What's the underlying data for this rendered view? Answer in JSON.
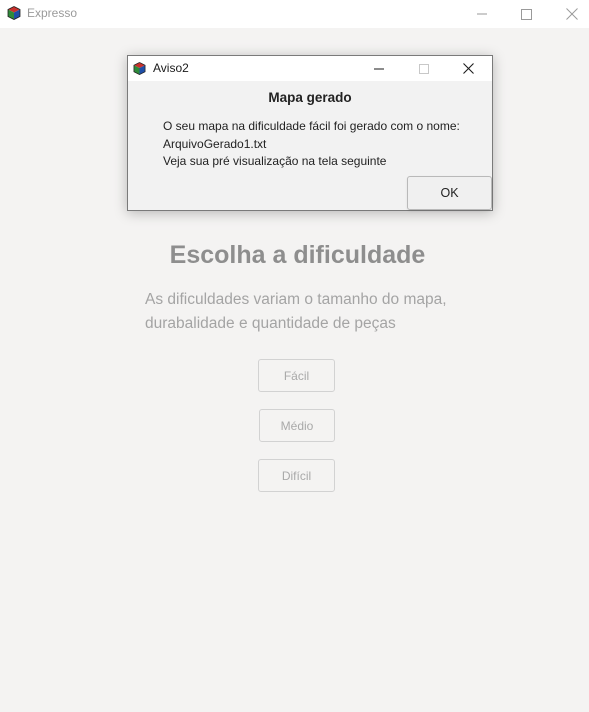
{
  "main_window": {
    "title": "Expresso",
    "icon": "cube-icon",
    "controls": [
      "minimize-icon",
      "maximize-icon",
      "close-icon"
    ]
  },
  "content": {
    "title": "Escolha a dificuldade",
    "description": "As dificuldades variam o tamanho do mapa, durabalidade e quantidade de peças",
    "buttons": {
      "easy": "Fácil",
      "medium": "Médio",
      "hard": "Difícil"
    }
  },
  "dialog": {
    "title": "Aviso2",
    "icon": "cube-icon",
    "heading": "Mapa gerado",
    "message_line1": "O seu mapa na dificuldade fácil foi gerado com o nome:",
    "message_line2": "ArquivoGerado1.txt",
    "message_line3": "Veja sua pré visualização na tela seguinte",
    "ok_label": "OK"
  },
  "colors": {
    "background": "#f4f3f2",
    "titlebar": "#ffffff",
    "disabled_text": "#a4a4a4"
  }
}
